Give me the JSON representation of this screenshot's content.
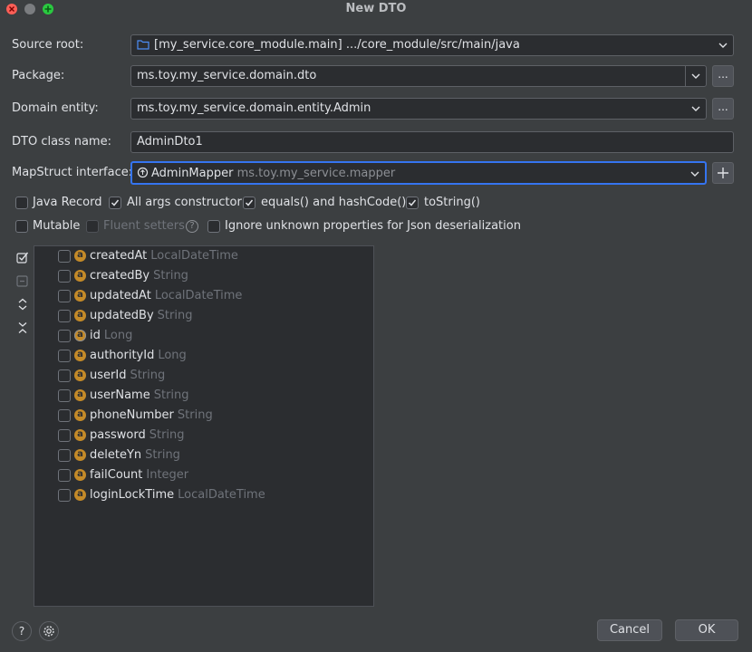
{
  "window": {
    "title": "New DTO"
  },
  "form": {
    "source_root_label": "Source root:",
    "source_root_value": "[my_service.core_module.main]",
    "source_root_path": ".../core_module/src/main/java",
    "package_label": "Package:",
    "package_value": "ms.toy.my_service.domain.dto",
    "domain_entity_label": "Domain entity:",
    "domain_entity_value": "ms.toy.my_service.domain.entity.Admin",
    "dto_class_label": "DTO class name:",
    "dto_class_value": "AdminDto1",
    "mapstruct_label": "MapStruct interface:",
    "mapstruct_value": "AdminMapper",
    "mapstruct_pkg": "ms.toy.my_service.mapper",
    "browse_label": "..."
  },
  "options": {
    "java_record": {
      "label": "Java Record",
      "checked": false
    },
    "all_args": {
      "label": "All args constructor",
      "checked": true
    },
    "equals_hash": {
      "label": "equals() and hashCode()",
      "checked": true
    },
    "to_string": {
      "label": "toString()",
      "checked": true
    },
    "mutable": {
      "label": "Mutable",
      "checked": false
    },
    "fluent": {
      "label": "Fluent setters",
      "checked": false
    },
    "ignore_unknown": {
      "label": "Ignore unknown properties for Json deserialization",
      "checked": false
    }
  },
  "fields": [
    {
      "name": "createdAt",
      "type": "LocalDateTime",
      "icon": "field-icon"
    },
    {
      "name": "createdBy",
      "type": "String",
      "icon": "field-icon"
    },
    {
      "name": "updatedAt",
      "type": "LocalDateTime",
      "icon": "field-icon"
    },
    {
      "name": "updatedBy",
      "type": "String",
      "icon": "field-icon"
    },
    {
      "name": "id",
      "type": "Long",
      "icon": "id-field-icon"
    },
    {
      "name": "authorityId",
      "type": "Long",
      "icon": "field-icon"
    },
    {
      "name": "userId",
      "type": "String",
      "icon": "field-icon"
    },
    {
      "name": "userName",
      "type": "String",
      "icon": "field-icon"
    },
    {
      "name": "phoneNumber",
      "type": "String",
      "icon": "field-icon"
    },
    {
      "name": "password",
      "type": "String",
      "icon": "field-icon"
    },
    {
      "name": "deleteYn",
      "type": "String",
      "icon": "field-icon"
    },
    {
      "name": "failCount",
      "type": "Integer",
      "icon": "field-icon"
    },
    {
      "name": "loginLockTime",
      "type": "LocalDateTime",
      "icon": "field-icon"
    }
  ],
  "footer": {
    "cancel_label": "Cancel",
    "ok_label": "OK",
    "help_label": "?"
  },
  "colors": {
    "accent": "#3574f0",
    "field_icon": "#c48a28",
    "background": "#3c3f41"
  }
}
